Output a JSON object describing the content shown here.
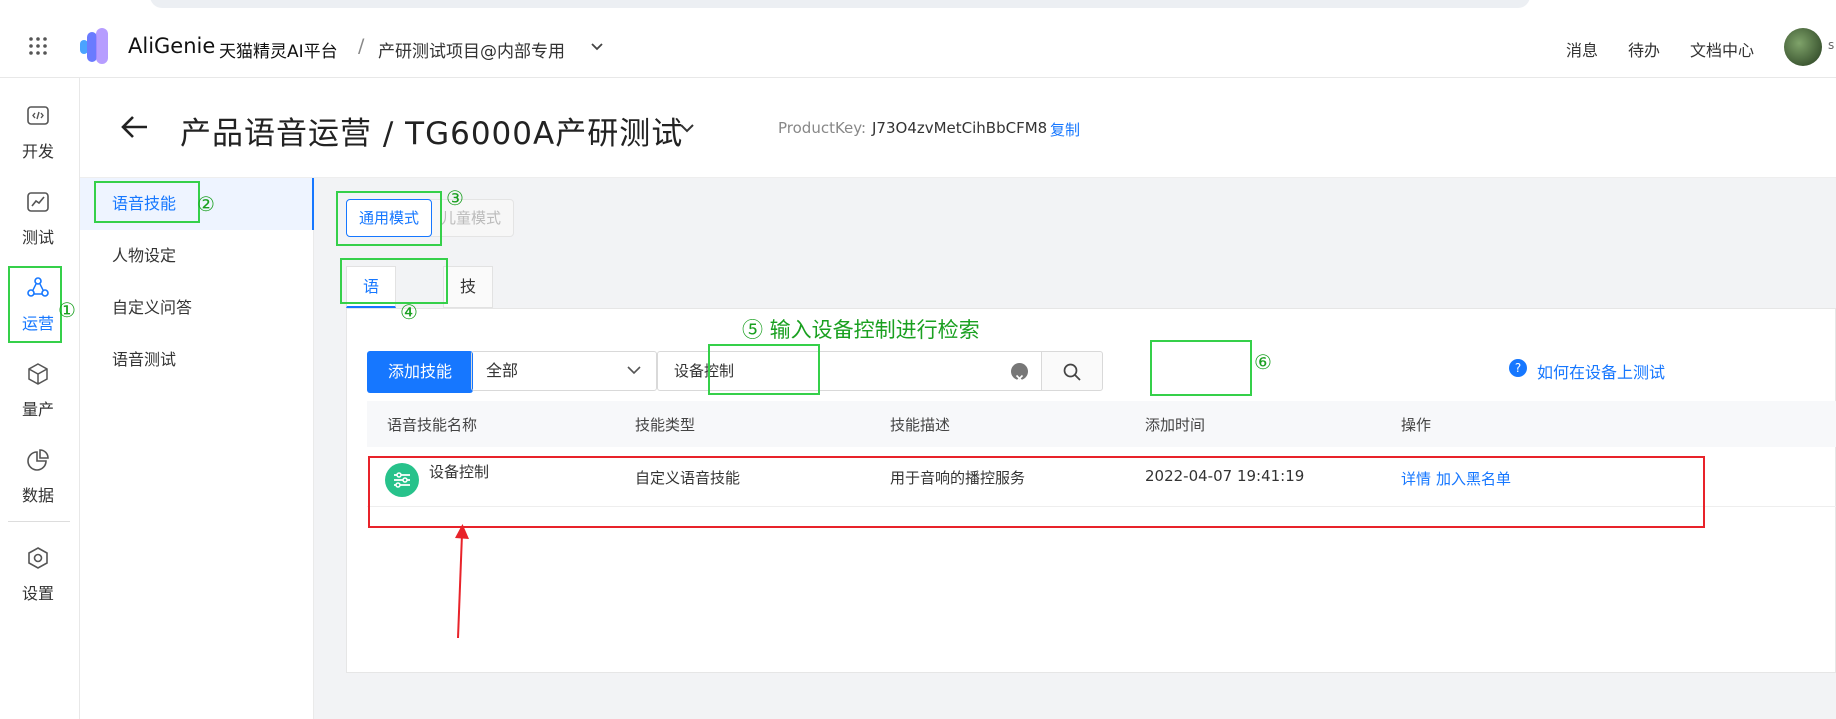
{
  "header": {
    "brand": "AliGenie",
    "brand_cn": "天猫精灵AI平台",
    "separator": "/",
    "project": "产研测试项目@内部专用",
    "links": [
      "消息",
      "待办",
      "文档中心"
    ],
    "avatar_tail": "s"
  },
  "leftnav": [
    {
      "label": "开发",
      "icon": "code-icon"
    },
    {
      "label": "测试",
      "icon": "chart-line-icon"
    },
    {
      "label": "运营",
      "icon": "nodes-icon"
    },
    {
      "label": "量产",
      "icon": "cube-icon"
    },
    {
      "label": "数据",
      "icon": "pie-icon"
    },
    {
      "label": "设置",
      "icon": "hexagon-gear-icon"
    }
  ],
  "page": {
    "title": "产品语音运营 / TG6000A产研测试",
    "product_key_label": "ProductKey:",
    "product_key_value": "J73O4zvMetCihBbCFM8",
    "copy_label": "复制"
  },
  "subnav": [
    "语音技能",
    "人物设定",
    "自定义问答",
    "语音测试"
  ],
  "modes": {
    "general": "通用模式",
    "kids": "儿童模式"
  },
  "tabs": [
    "语音技能",
    "技能黑名单"
  ],
  "toolbar": {
    "add_button": "添加技能",
    "select_value": "全部",
    "search_value": "设备控制",
    "help_link": "如何在设备上测试"
  },
  "table": {
    "headers": [
      "语音技能名称",
      "技能类型",
      "技能描述",
      "添加时间",
      "操作"
    ],
    "rows": [
      {
        "name": "设备控制",
        "type": "自定义语音技能",
        "description": "用于音响的播控服务",
        "added": "2022-04-07 19:41:19",
        "actions": [
          "详情",
          "加入黑名单"
        ]
      }
    ]
  },
  "annotations": {
    "n1": "①",
    "n2": "②",
    "n3": "③",
    "n4": "④",
    "n6": "⑥",
    "n5_text": "⑤ 输入设备控制进行检索"
  },
  "colors": {
    "accent": "#1677ff",
    "annotation_green": "#35d04a",
    "annotation_red": "#e8232a",
    "skill_icon": "#27c28b"
  }
}
